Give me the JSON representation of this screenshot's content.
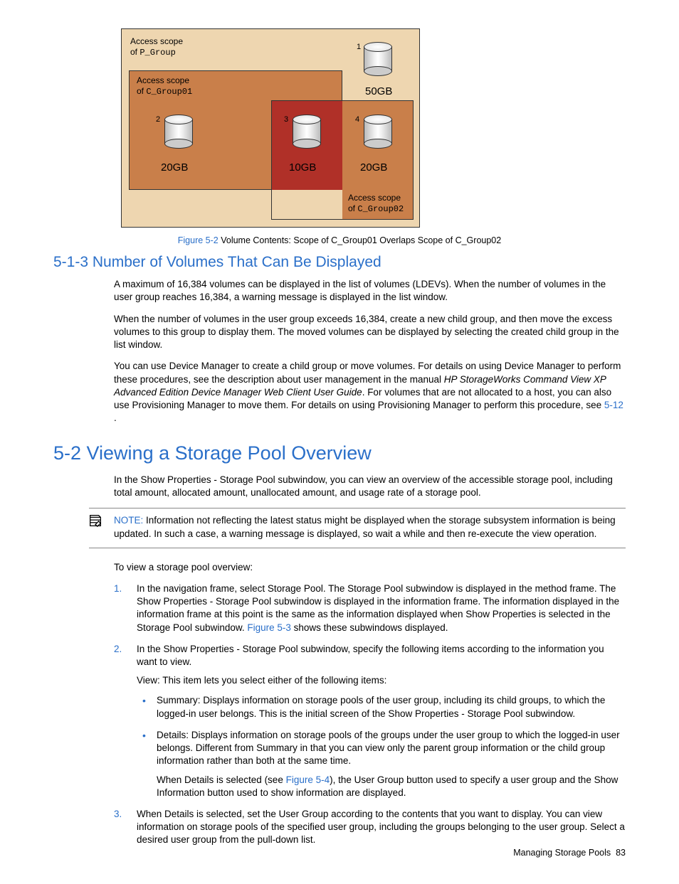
{
  "figure": {
    "scope_p_label1": "Access scope",
    "scope_p_label2": "of",
    "scope_p_group": "P_Group",
    "scope_c1_label1": "Access scope",
    "scope_c1_label2": "of",
    "scope_c1_group": "C_Group01",
    "scope_c2_label1": "Access scope",
    "scope_c2_label2": "of",
    "scope_c2_group": "C_Group02",
    "vol1_num": "1",
    "vol1_size": "50GB",
    "vol2_num": "2",
    "vol2_size": "20GB",
    "vol3_num": "3",
    "vol3_size": "10GB",
    "vol4_num": "4",
    "vol4_size": "20GB",
    "caption_ref": "Figure 5-2",
    "caption_text": " Volume Contents: Scope of C_Group01 Overlaps Scope of C_Group02"
  },
  "s513": {
    "heading": "5-1-3 Number of Volumes That Can Be Displayed",
    "p1": "A maximum of 16,384 volumes can be displayed in the list of volumes (LDEVs). When the number of volumes in the user group reaches 16,384, a warning message is displayed in the list window.",
    "p2": "When the number of volumes in the user group exceeds 16,384, create a new child group, and then move the excess volumes to this group to display them. The moved volumes can be displayed by selecting the created child group in the list window.",
    "p3a": "You can use Device Manager to create a child group or move volumes. For details on using Device Manager to perform these procedures, see the description about user management in the manual ",
    "p3_italic": "HP StorageWorks Command View XP Advanced Edition Device Manager Web Client User Guide",
    "p3b": ". For volumes that are not allocated to a host, you can also use Provisioning Manager to move them. For details on using Provisioning Manager to perform this procedure, see ",
    "p3_link": "5-12 ",
    "p3c": "."
  },
  "s52": {
    "heading": "5-2 Viewing a Storage Pool Overview",
    "intro": "In the Show Properties - Storage Pool subwindow, you can view an overview of the accessible storage pool, including total amount, allocated amount, unallocated amount, and usage rate of a storage pool.",
    "note_label": "NOTE:",
    "note_text": "  Information not reflecting the latest status might be displayed when the storage subsystem information is being updated. In such a case, a warning message is displayed, so wait a while and then re-execute the view operation.",
    "lead": "To view a storage pool overview:",
    "step1_num": "1.",
    "step1a": "In the navigation frame, select Storage Pool. The Storage Pool subwindow is displayed in the method frame. The Show Properties - Storage Pool subwindow is displayed in the information frame. The information displayed in the information frame at this point is the same as the information displayed when Show Properties is selected in the Storage Pool subwindow. ",
    "step1_link": "Figure 5-3",
    "step1b": " shows these subwindows displayed.",
    "step2_num": "2.",
    "step2_p1": "In the Show Properties - Storage Pool subwindow, specify the following items according to the information you want to view.",
    "step2_p2": "View: This item lets you select either of the following items:",
    "step2_b1": "Summary: Displays information on storage pools of the user group, including its child groups, to which the logged-in user belongs. This is the initial screen of the Show Properties - Storage Pool subwindow.",
    "step2_b2a": "Details: Displays information on storage pools of the groups under the user group to which the logged-in user belongs. Different from Summary in that you can view only the parent group information or the child group information rather than both at the same time.",
    "step2_b2b_pre": "When Details is selected (see ",
    "step2_b2b_link": "Figure 5-4",
    "step2_b2b_post": "), the User Group button used to specify a user group and the Show Information button used to show information are displayed.",
    "step3_num": "3.",
    "step3": "When Details is selected, set the User Group according to the contents that you want to display. You can view information on storage pools of the specified user group, including the groups belonging to the user group. Select a desired user group from the pull-down list."
  },
  "footer": {
    "text": "Managing Storage Pools",
    "page": "83"
  }
}
